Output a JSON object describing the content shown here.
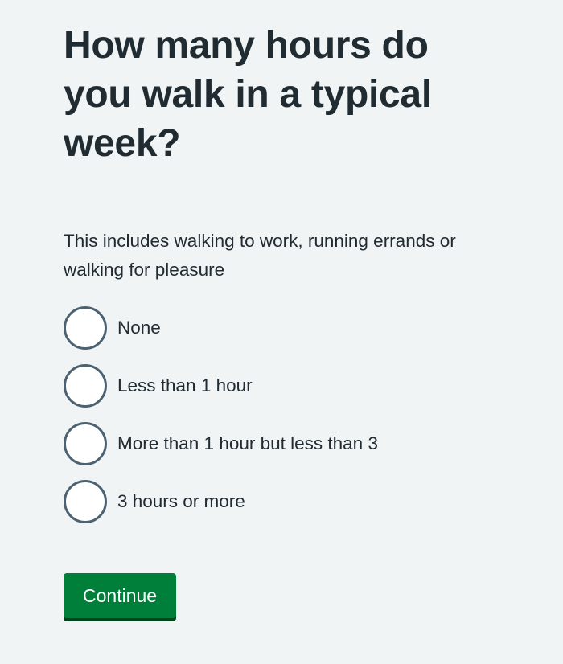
{
  "question": {
    "title": "How many hours do you walk in a typical week?",
    "hint": "This includes walking to work, running errands or walking for pleasure"
  },
  "options": [
    {
      "label": "None"
    },
    {
      "label": "Less than 1 hour"
    },
    {
      "label": "More than 1 hour but less than 3"
    },
    {
      "label": "3 hours or more"
    }
  ],
  "actions": {
    "continue_label": "Continue"
  },
  "colors": {
    "background": "#f0f4f5",
    "text": "#212b32",
    "radio_border": "#4c6272",
    "button": "#007f3b",
    "button_shadow": "#00401e"
  }
}
